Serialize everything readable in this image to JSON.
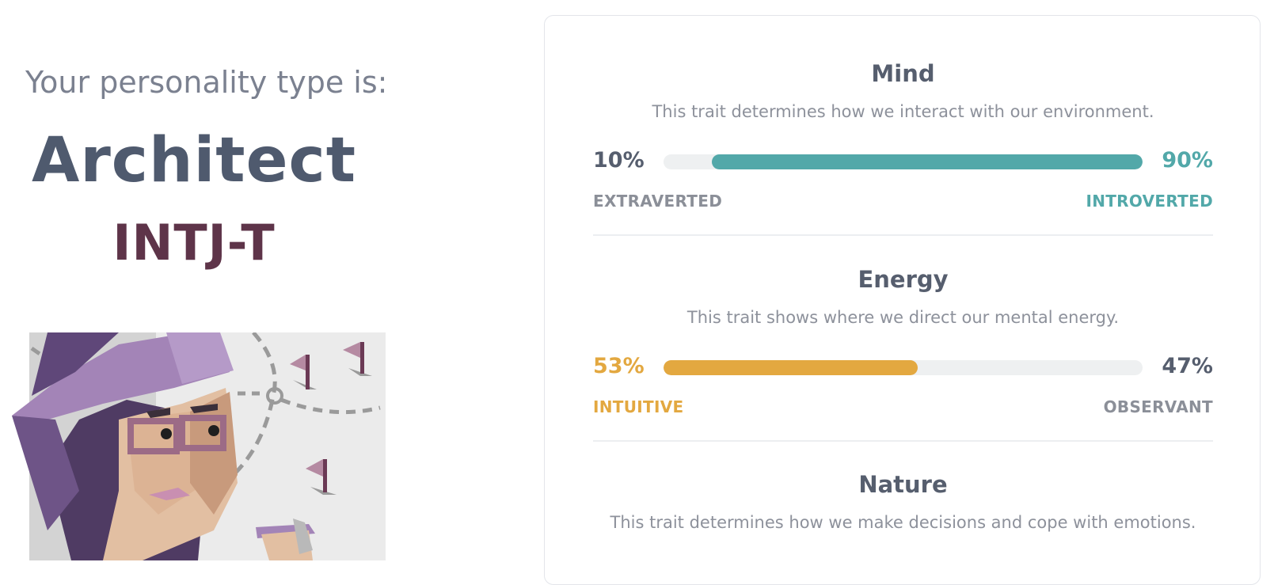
{
  "header": {
    "intro": "Your personality type is:",
    "type_name": "Architect",
    "type_code": "INTJ-T"
  },
  "traits": [
    {
      "title": "Mind",
      "description": "This trait determines how we interact with our environment.",
      "left_percent": "10%",
      "right_percent": "90%",
      "left_label": "EXTRAVERTED",
      "right_label": "INTROVERTED",
      "dominant_side": "right",
      "dominant_fraction": 0.9,
      "color": "#52a8a9"
    },
    {
      "title": "Energy",
      "description": "This trait shows where we direct our mental energy.",
      "left_percent": "53%",
      "right_percent": "47%",
      "left_label": "INTUITIVE",
      "right_label": "OBSERVANT",
      "dominant_side": "left",
      "dominant_fraction": 0.53,
      "color": "#e3a840"
    },
    {
      "title": "Nature",
      "description": "This trait determines how we make decisions and cope with emotions."
    }
  ],
  "colors": {
    "muted_text": "#8b8f98",
    "heading": "#4f5a6e",
    "type_code": "#5e3449",
    "bar_track": "#eef0f1"
  },
  "icons": [
    "architect-illustration",
    "flag-icon"
  ]
}
